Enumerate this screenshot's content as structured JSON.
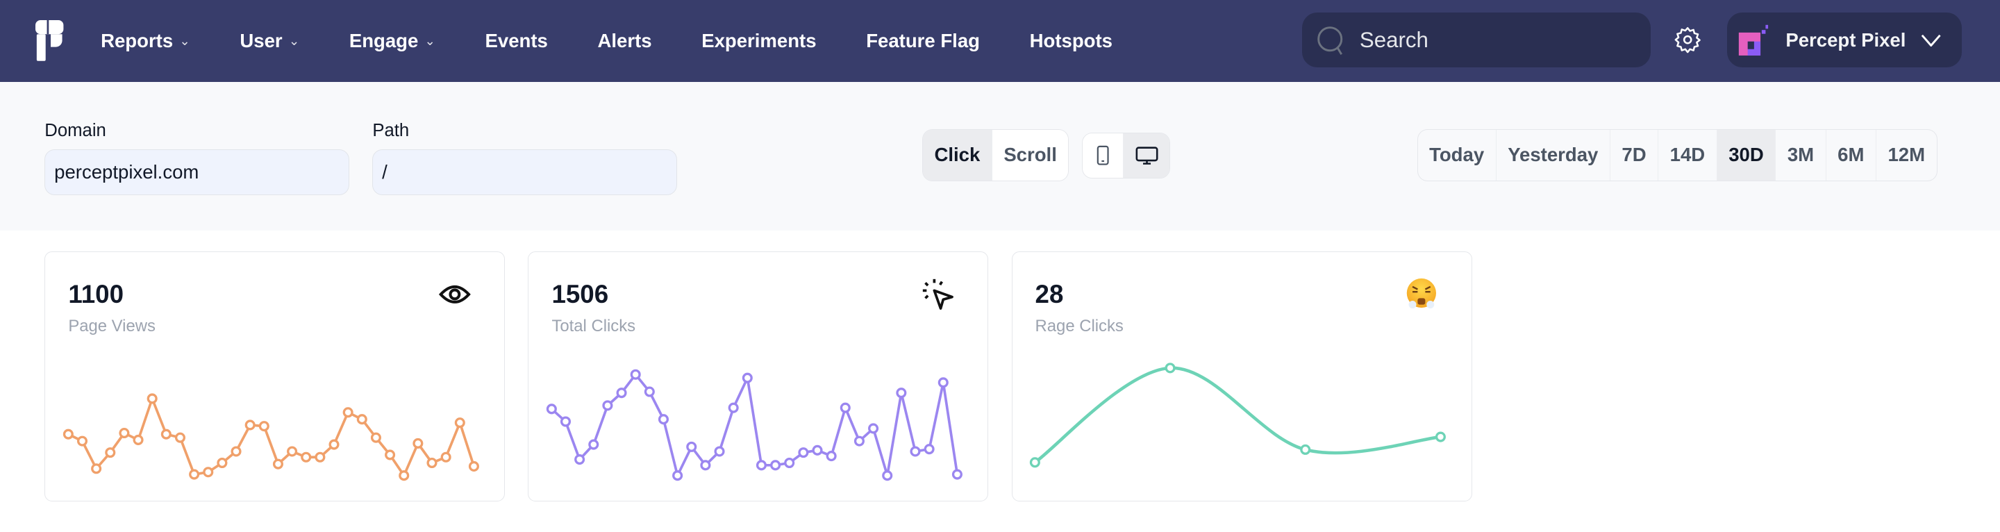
{
  "nav": {
    "menu": [
      {
        "label": "Reports",
        "dropdown": true
      },
      {
        "label": "User",
        "dropdown": true
      },
      {
        "label": "Engage",
        "dropdown": true
      },
      {
        "label": "Events",
        "dropdown": false
      },
      {
        "label": "Alerts",
        "dropdown": false
      },
      {
        "label": "Experiments",
        "dropdown": false
      },
      {
        "label": "Feature Flag",
        "dropdown": false
      },
      {
        "label": "Hotspots",
        "dropdown": false
      }
    ],
    "search_placeholder": "Search",
    "workspace": "Percept Pixel",
    "bg_color": "#383d6b"
  },
  "filters": {
    "domain_label": "Domain",
    "domain_value": "perceptpixel.com",
    "path_label": "Path",
    "path_value": "/",
    "mode": {
      "options": [
        "Click",
        "Scroll"
      ],
      "selected": "Click"
    },
    "device": {
      "options": [
        "mobile-icon",
        "desktop-icon"
      ],
      "selected": "desktop-icon"
    },
    "range": {
      "options": [
        "Today",
        "Yesterday",
        "7D",
        "14D",
        "30D",
        "3M",
        "6M",
        "12M"
      ],
      "selected": "30D"
    }
  },
  "cards": [
    {
      "value": "1100",
      "label": "Page Views",
      "icon": "eye-icon"
    },
    {
      "value": "1506",
      "label": "Total Clicks",
      "icon": "cursor-click-icon"
    },
    {
      "value": "28",
      "label": "Rage Clicks",
      "icon": "angry-face-emoji-icon"
    }
  ],
  "chart_data": [
    {
      "type": "line",
      "color": "#f0a06a",
      "ylim": [
        0,
        50
      ],
      "smooth": false,
      "values": [
        19.5,
        16.5,
        4.5,
        11.5,
        20,
        17,
        35,
        19.5,
        18,
        2,
        3,
        7,
        12,
        23.5,
        23,
        6.5,
        12,
        9.5,
        9.5,
        15,
        29,
        26,
        18,
        10.5,
        1.5,
        15.5,
        7,
        9.5,
        24.5,
        5.5
      ]
    },
    {
      "type": "line",
      "color": "#9b86f0",
      "ylim": [
        0,
        50
      ],
      "smooth": false,
      "values": [
        30.5,
        25,
        8.5,
        15,
        32,
        37.5,
        45.5,
        38,
        26,
        1.5,
        14,
        6,
        12,
        31,
        44,
        6,
        6,
        7,
        11.5,
        12.5,
        10,
        31,
        16.5,
        22,
        1.5,
        37.5,
        12,
        13,
        42,
        2
      ]
    },
    {
      "type": "line",
      "color": "#6dd3b6",
      "ylim": [
        0,
        90
      ],
      "smooth": true,
      "values": [
        13,
        87,
        23,
        33
      ]
    }
  ]
}
